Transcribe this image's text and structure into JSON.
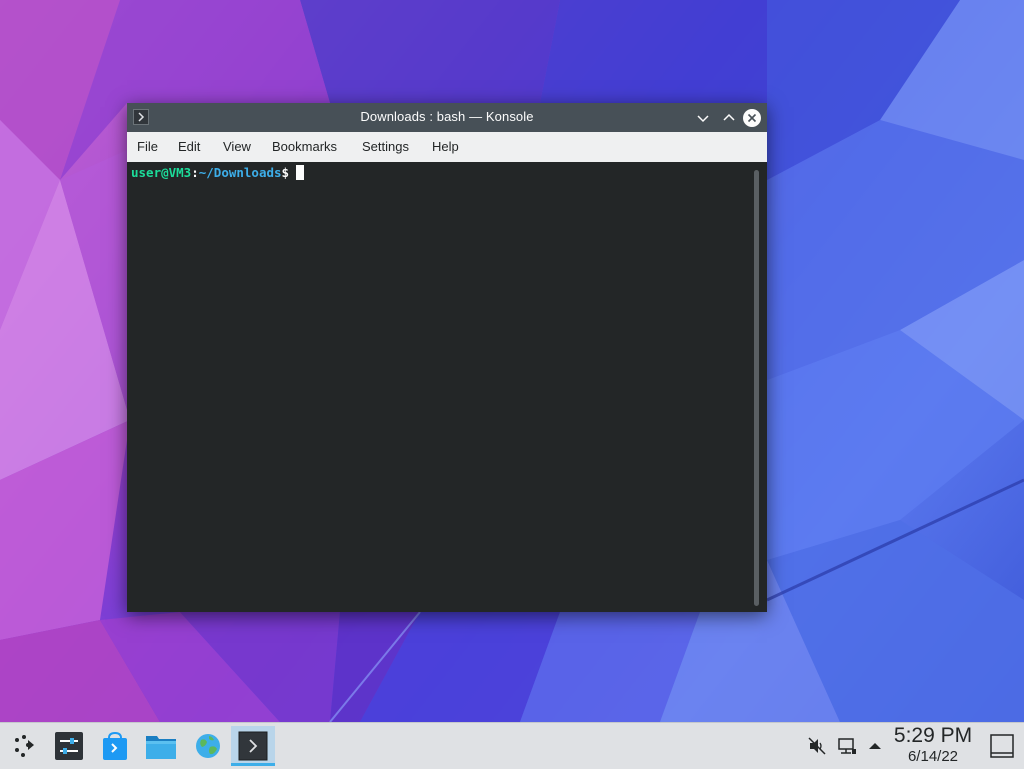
{
  "window": {
    "title": "Downloads : bash — Konsole",
    "menu": [
      "File",
      "Edit",
      "View",
      "Bookmarks",
      "Settings",
      "Help"
    ]
  },
  "terminal": {
    "user_host": "user@VM3",
    "colon": ":",
    "path": "~/Downloads",
    "dollar": "$"
  },
  "taskbar": {
    "launcher_icons": [
      "application-launcher-icon",
      "system-settings-icon",
      "discover-store-icon",
      "dolphin-file-manager-icon",
      "web-browser-globe-icon",
      "konsole-terminal-icon"
    ],
    "tray_icons": [
      "volume-muted-icon",
      "network-wired-icon",
      "tray-expand-arrow-icon"
    ],
    "clock": {
      "time": "5:29 PM",
      "date": "6/14/22"
    },
    "show_desktop_icon": "show-desktop-icon"
  },
  "colors": {
    "accent": "#3daee9",
    "terminal_bg": "#232627",
    "prompt_user": "#1cdc9a",
    "titlebar": "#475057"
  }
}
